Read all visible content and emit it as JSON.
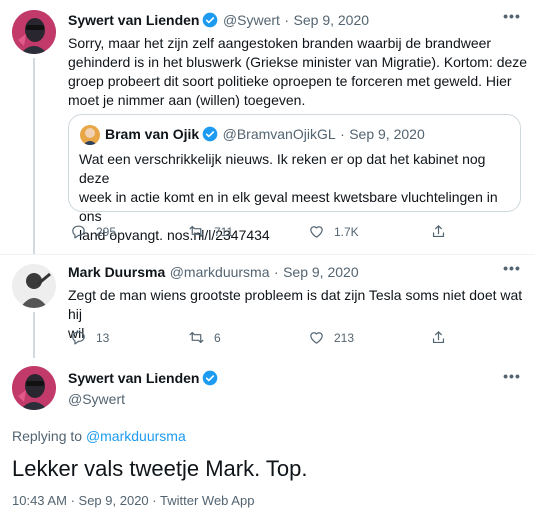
{
  "tweet1": {
    "author_name": "Sywert van Lienden",
    "handle": "@Sywert",
    "date": "Sep 9, 2020",
    "text_lines": [
      "Sorry, maar het zijn zelf aangestoken branden waarbij de brandweer",
      "gehinderd is in het bluswerk (Griekse minister van Migratie). Kortom: deze",
      "groep probeert dit soort politieke oproepen te forceren met geweld. Hier",
      "moet je nimmer aan (willen) toegeven."
    ],
    "quote": {
      "author_name": "Bram van Ojik",
      "handle": "@BramvanOjikGL",
      "date": "Sep 9, 2020",
      "text_lines": [
        "Wat een verschrikkelijk nieuws. Ik reken er op dat het kabinet nog deze",
        "week in actie komt en in elk geval meest kwetsbare vluchtelingen  in ons",
        "land opvangt. nos.nl/l/2347434"
      ]
    },
    "replies": "295",
    "retweets": "711",
    "likes": "1.7K"
  },
  "tweet2": {
    "author_name": "Mark Duursma",
    "handle": "@markduursma",
    "date": "Sep 9, 2020",
    "text_lines": [
      "Zegt de man wiens grootste probleem is dat zijn Tesla soms niet doet wat hij",
      "wil"
    ],
    "replies": "13",
    "retweets": "6",
    "likes": "213"
  },
  "main": {
    "author_name": "Sywert van Lienden",
    "handle": "@Sywert",
    "replying_prefix": "Replying to",
    "replying_to": "@markduursma",
    "text": "Lekker vals tweetje Mark. Top.",
    "time": "10:43 AM",
    "date": "Sep 9, 2020",
    "source": "Twitter Web App"
  },
  "separator": "·",
  "colors": {
    "accent": "#1d9bf0",
    "secondary_text": "#536471",
    "verified": "#1d9bf0",
    "thread_line": "#cfd9de"
  }
}
